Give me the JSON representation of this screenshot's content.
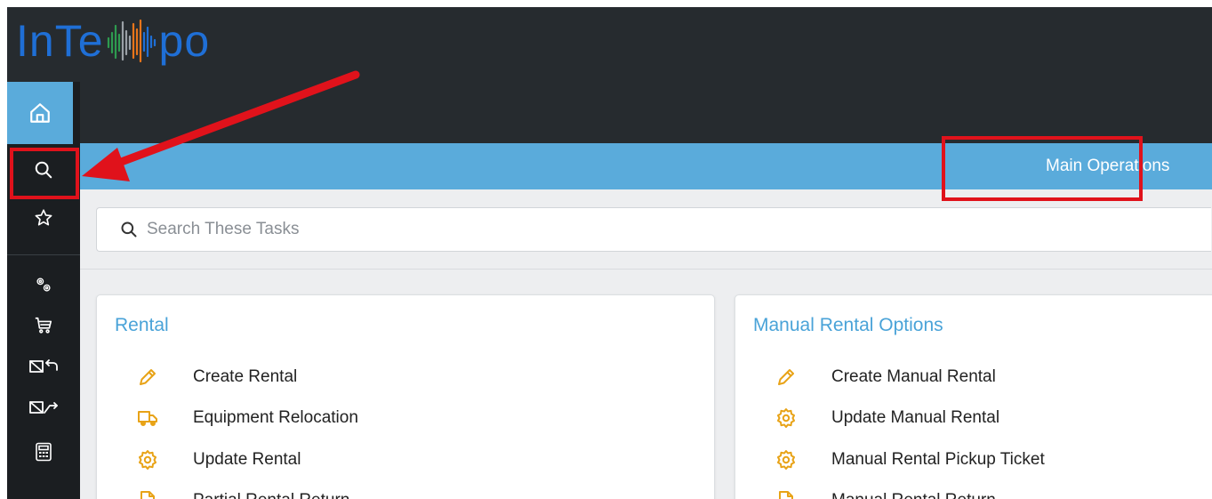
{
  "app": {
    "logo_left": "InTe",
    "logo_right": "po",
    "brand_color": "#1f6fd6",
    "accent_color": "#5aabdb"
  },
  "rail": {
    "items": [
      {
        "icon": "home-icon"
      },
      {
        "icon": "search-icon"
      },
      {
        "icon": "star-icon"
      },
      {
        "icon": "gears-icon"
      },
      {
        "icon": "cart-icon"
      },
      {
        "icon": "return-icon"
      },
      {
        "icon": "send-icon"
      },
      {
        "icon": "calculator-icon"
      }
    ]
  },
  "header": {
    "tab_label": "Main Operations"
  },
  "search": {
    "placeholder": "Search These Tasks"
  },
  "cards": [
    {
      "title": "Rental",
      "items": [
        {
          "label": "Create Rental",
          "icon": "pencil-icon"
        },
        {
          "label": "Equipment Relocation",
          "icon": "truck-icon"
        },
        {
          "label": "Update Rental",
          "icon": "gear-icon"
        },
        {
          "label": "Partial Rental Return",
          "icon": "document-icon"
        }
      ]
    },
    {
      "title": "Manual Rental Options",
      "items": [
        {
          "label": "Create Manual Rental",
          "icon": "pencil-icon"
        },
        {
          "label": "Update Manual Rental",
          "icon": "gear-icon"
        },
        {
          "label": "Manual Rental Pickup Ticket",
          "icon": "gear-icon"
        },
        {
          "label": "Manual Rental Return",
          "icon": "document-icon"
        }
      ]
    }
  ],
  "colors": {
    "icon_orange": "#e8a317",
    "annotation_red": "#e0121b"
  }
}
